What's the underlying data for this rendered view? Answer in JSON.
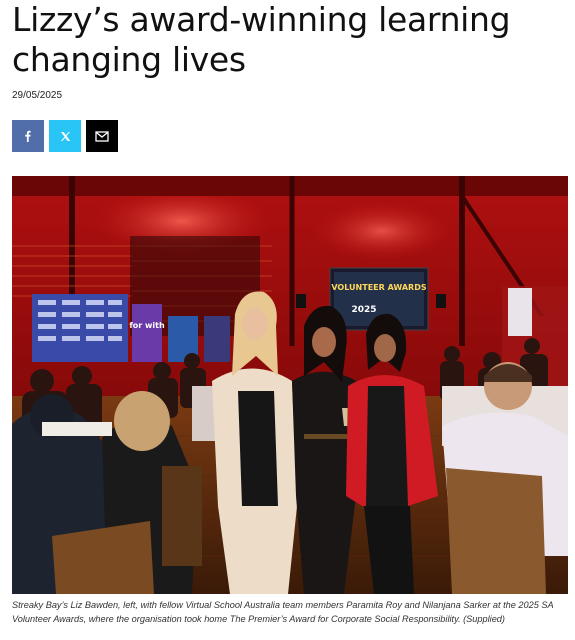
{
  "article": {
    "title": "Lizzy’s award-winning learning changing lives",
    "date": "29/05/2025",
    "caption": "Streaky Bay’s Liz Bawden, left, with fellow Virtual School Australia team members Paramita Roy and Nilanjana Sarker at the 2025 SA Volunteer Awards, where the organisation took home The Premier’s Award for Corporate Social Responsibility. (Supplied)"
  },
  "share": {
    "buttons": [
      {
        "name": "facebook",
        "icon": "facebook-icon",
        "color": "#516eab"
      },
      {
        "name": "x",
        "icon": "x-logo-icon",
        "color": "#29c5f6"
      },
      {
        "name": "email",
        "icon": "envelope-icon",
        "color": "#000000"
      }
    ]
  },
  "photo": {
    "screen_text": "VOLUNTEER AWARDS",
    "screen_year": "2025",
    "banner_text": "for with"
  }
}
